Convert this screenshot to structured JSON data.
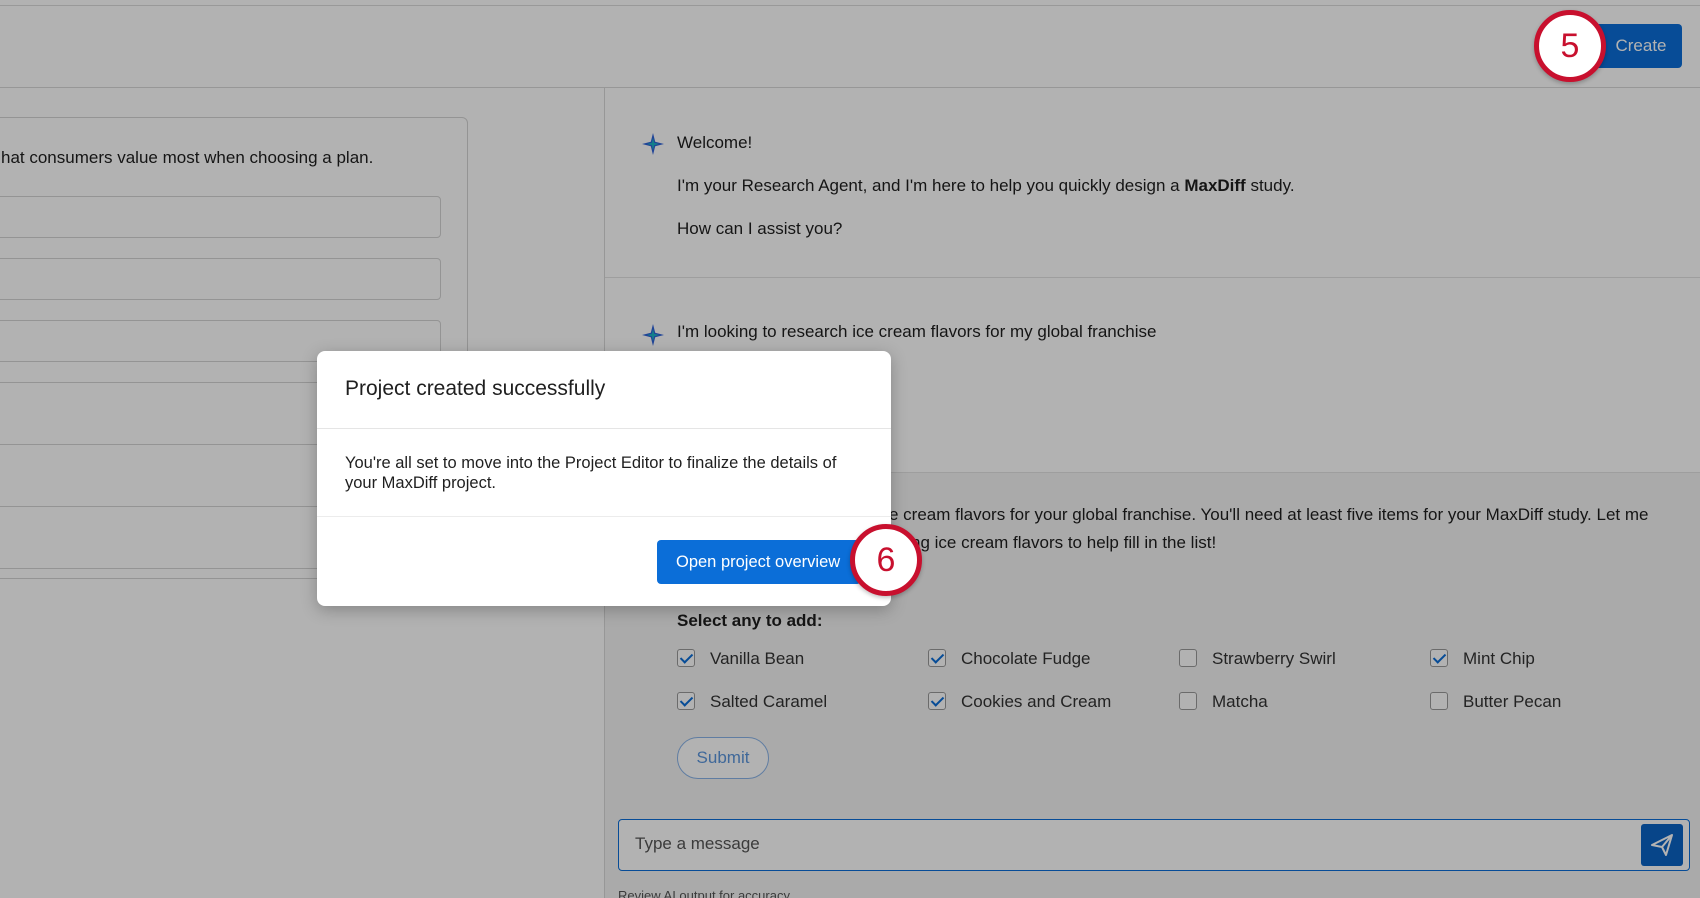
{
  "header": {
    "create_label": "Create",
    "step_badge_5": "5"
  },
  "left": {
    "prompt_text": "hat consumers value most when choosing a plan."
  },
  "chat": {
    "welcome": "Welcome!",
    "intro_pre": "I'm your Research Agent, and I'm here to help you quickly design a ",
    "intro_bold": "MaxDiff",
    "intro_post": " study.",
    "assist": "How can I assist you?",
    "user_msg": "I'm looking to research ice cream flavors for my global franchise",
    "reply_line1": "e cream flavors for your global franchise. You'll need at least five items for your MaxDiff study. Let me",
    "reply_line2": "ng ice cream flavors to help fill in the list!",
    "select_label": "Select any to add:",
    "options": [
      {
        "label": "Vanilla Bean",
        "checked": true
      },
      {
        "label": "Chocolate Fudge",
        "checked": true
      },
      {
        "label": "Strawberry Swirl",
        "checked": false
      },
      {
        "label": "Mint Chip",
        "checked": true
      },
      {
        "label": "Salted Caramel",
        "checked": true
      },
      {
        "label": "Cookies and Cream",
        "checked": true
      },
      {
        "label": "Matcha",
        "checked": false
      },
      {
        "label": "Butter Pecan",
        "checked": false
      }
    ],
    "submit_label": "Submit",
    "composer_placeholder": "Type a message",
    "review_note": "Review AI output for accuracy"
  },
  "modal": {
    "title": "Project created successfully",
    "body": "You're all set to move into the Project Editor to finalize the details of your MaxDiff project.",
    "button_label": "Open project overview",
    "step_badge_6": "6"
  },
  "colors": {
    "accent": "#0b6ed8",
    "badge_red": "#c8102e"
  },
  "icons": [
    "sparkle-icon",
    "send-icon",
    "checkbox-icon"
  ]
}
